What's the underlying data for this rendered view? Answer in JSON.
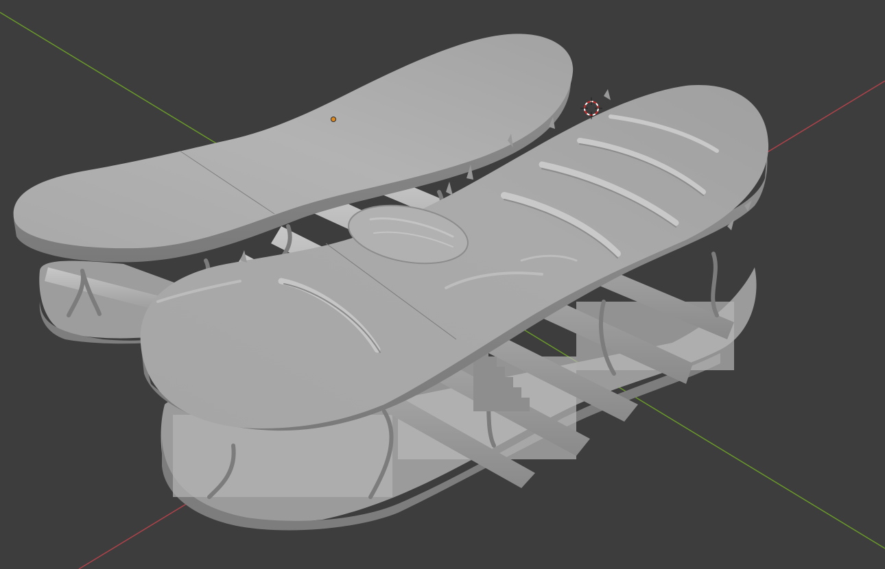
{
  "viewport": {
    "background": "#3d3d3d",
    "axis_x_color": "#b0424a",
    "axis_y_color": "#6a9a2a",
    "mesh_light": "#aeaeae",
    "mesh_mid": "#9a9a9a",
    "mesh_dark": "#6e6e6e",
    "origin_marker_color": "#e08a1e",
    "cursor_3d": "3d-cursor-icon"
  }
}
